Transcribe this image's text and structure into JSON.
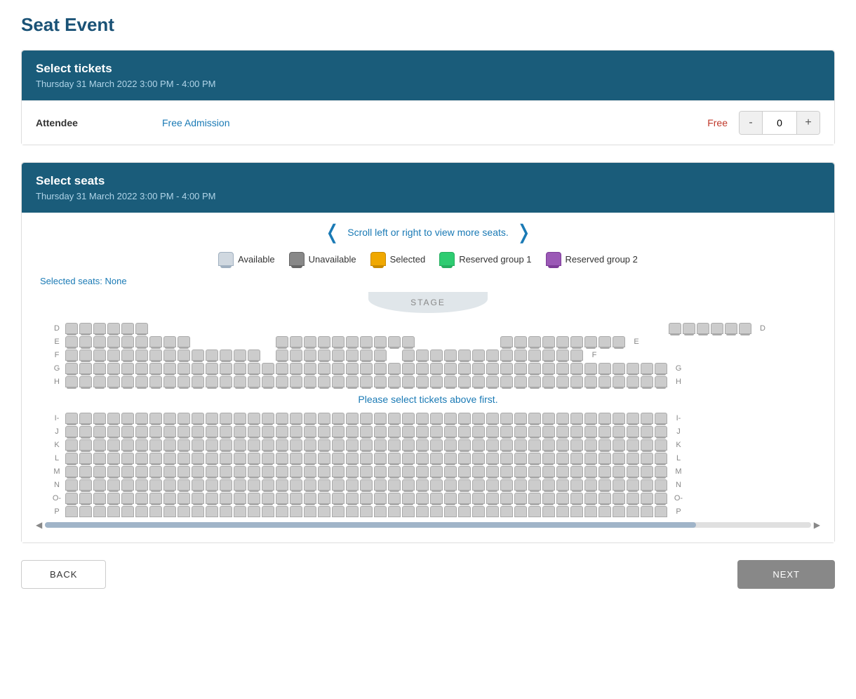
{
  "page": {
    "title": "Seat Event"
  },
  "tickets_section": {
    "header": "Select tickets",
    "datetime": "Thursday 31 March 2022 3:00 PM - 4:00 PM",
    "row": {
      "label": "Attendee",
      "type": "Free Admission",
      "price": "Free",
      "quantity": 0,
      "minus_label": "-",
      "plus_label": "+"
    }
  },
  "seats_section": {
    "header": "Select seats",
    "datetime": "Thursday 31 March 2022 3:00 PM - 4:00 PM",
    "scroll_hint": "Scroll left or right to view more seats.",
    "legend": [
      {
        "key": "available",
        "label": "Available"
      },
      {
        "key": "unavailable",
        "label": "Unavailable"
      },
      {
        "key": "selected",
        "label": "Selected"
      },
      {
        "key": "reserved1",
        "label": "Reserved group 1"
      },
      {
        "key": "reserved2",
        "label": "Reserved group 2"
      }
    ],
    "selected_seats_text": "Selected seats: None",
    "stage_label": "STAGE",
    "please_select_text": "Please select tickets above first.",
    "rows": [
      "D",
      "E",
      "F",
      "G",
      "H",
      "I-",
      "J",
      "K",
      "L",
      "M",
      "N",
      "O-",
      "P"
    ]
  },
  "footer": {
    "back_label": "BACK",
    "next_label": "NEXT"
  }
}
